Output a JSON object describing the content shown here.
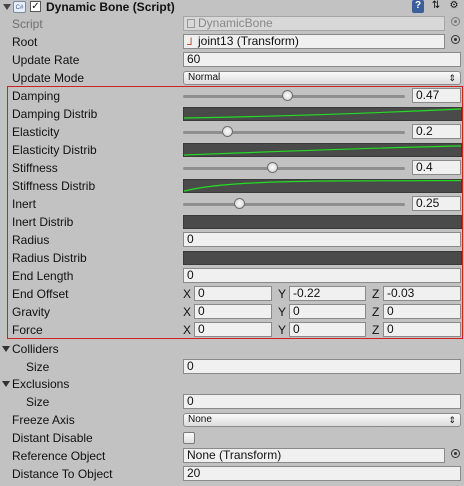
{
  "header": {
    "title": "Dynamic Bone (Script)",
    "script_icon_text": "C#"
  },
  "script_row": {
    "label": "Script",
    "value": "DynamicBone"
  },
  "root_row": {
    "label": "Root",
    "value": "joint13 (Transform)"
  },
  "update_rate": {
    "label": "Update Rate",
    "value": "60"
  },
  "update_mode": {
    "label": "Update Mode",
    "value": "Normal"
  },
  "sliders": [
    {
      "label": "Damping",
      "value": "0.47",
      "fraction": 0.47
    },
    {
      "label": "Elasticity",
      "value": "0.2",
      "fraction": 0.2
    },
    {
      "label": "Stiffness",
      "value": "0.4",
      "fraction": 0.4
    },
    {
      "label": "Inert",
      "value": "0.25",
      "fraction": 0.25
    }
  ],
  "distribs": [
    {
      "label": "Damping Distrib"
    },
    {
      "label": "Elasticity Distrib"
    },
    {
      "label": "Stiffness Distrib"
    },
    {
      "label": "Inert Distrib"
    },
    {
      "label": "Radius Distrib"
    }
  ],
  "radius": {
    "label": "Radius",
    "value": "0"
  },
  "end_length": {
    "label": "End Length",
    "value": "0"
  },
  "end_offset": {
    "label": "End Offset",
    "x": "0",
    "y": "-0.22",
    "z": "-0.03"
  },
  "gravity": {
    "label": "Gravity",
    "x": "0",
    "y": "0",
    "z": "0"
  },
  "force": {
    "label": "Force",
    "x": "0",
    "y": "0",
    "z": "0"
  },
  "axis_labels": {
    "x": "X",
    "y": "Y",
    "z": "Z"
  },
  "colliders": {
    "label": "Colliders",
    "size_label": "Size",
    "size_value": "0"
  },
  "exclusions": {
    "label": "Exclusions",
    "size_label": "Size",
    "size_value": "0"
  },
  "freeze_axis": {
    "label": "Freeze Axis",
    "value": "None"
  },
  "distant_disable": {
    "label": "Distant Disable",
    "checked": false
  },
  "reference_object": {
    "label": "Reference Object",
    "value": "None (Transform)"
  },
  "distance_to_object": {
    "label": "Distance To Object",
    "value": "20"
  },
  "colors": {
    "highlight_border": "#d02020",
    "curve_line": "#22dd22",
    "curve_bg": "#4a4a4a"
  }
}
